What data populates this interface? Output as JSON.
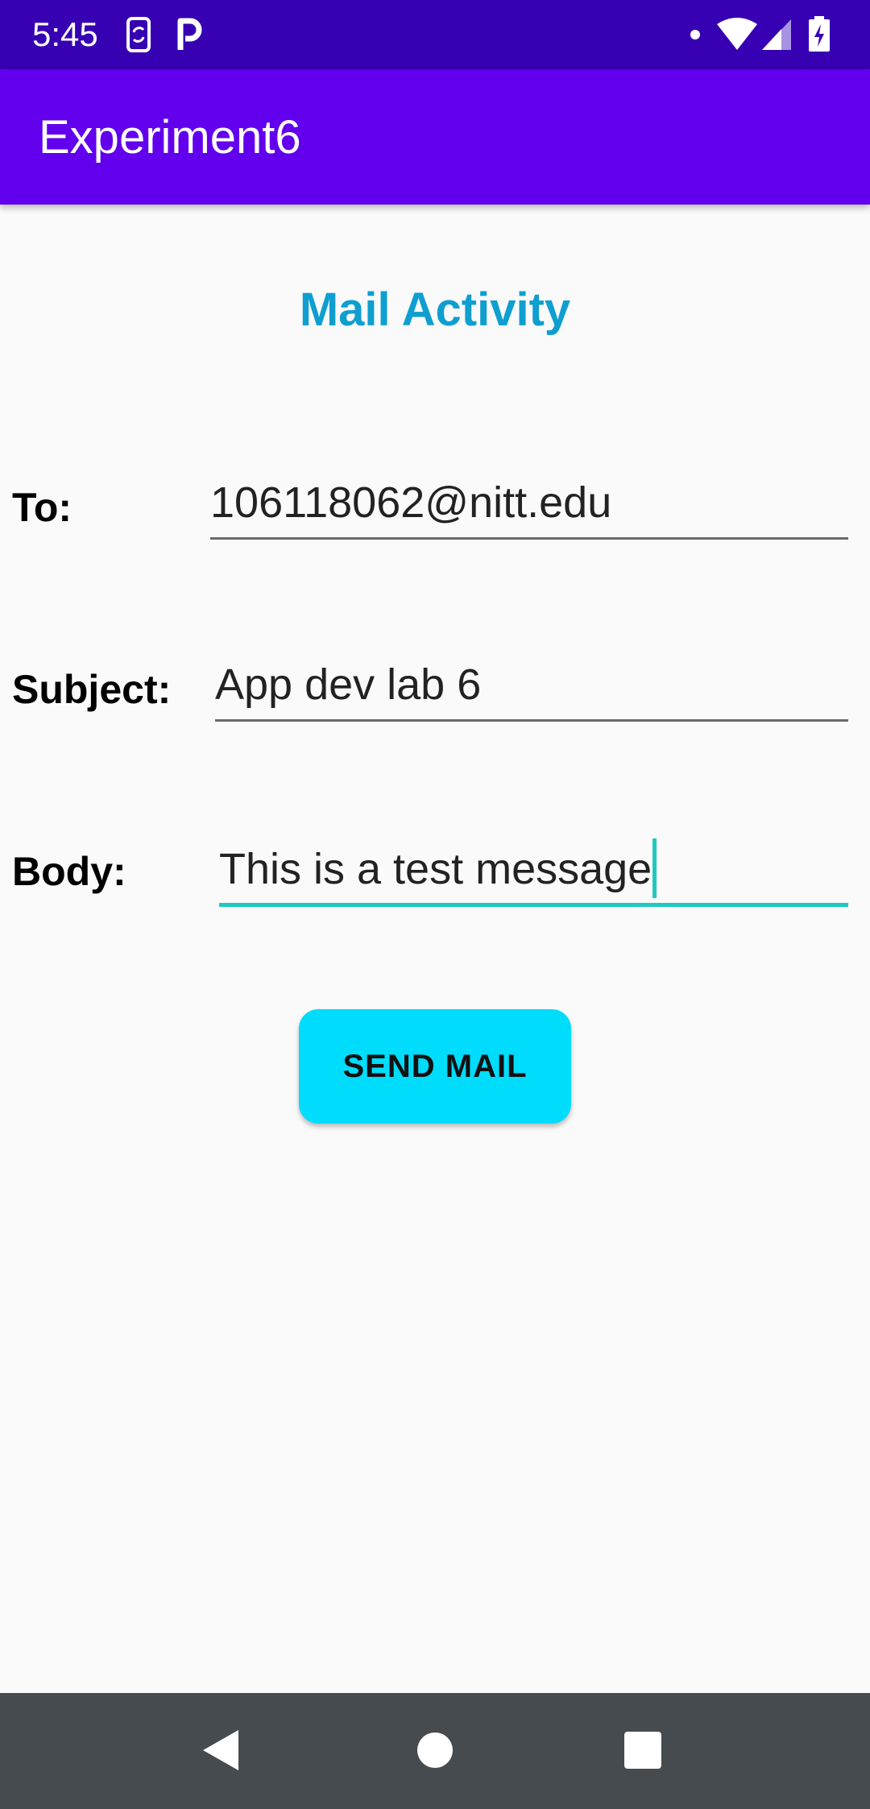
{
  "status_bar": {
    "time": "5:45",
    "icons": [
      "phone-sync-icon",
      "parking-app-icon",
      "notification-dot-icon",
      "wifi-icon",
      "cell-signal-icon",
      "battery-charging-icon"
    ],
    "background": "#3700b3"
  },
  "app_bar": {
    "title": "Experiment6",
    "background": "#6200ee"
  },
  "screen": {
    "heading": "Mail Activity",
    "heading_color": "#0e9fd0"
  },
  "form": {
    "to_label": "To:",
    "to_value": "106118062@nitt.edu",
    "subject_label": "Subject:",
    "subject_value": "App dev lab 6",
    "body_label": "Body:",
    "body_value": "This is a test message",
    "focus_color": "#1ec9c0"
  },
  "send_button": {
    "label": "SEND MAIL",
    "color": "#00dcfc"
  },
  "nav_bar": {
    "buttons": [
      "back-icon",
      "home-icon",
      "recents-icon"
    ],
    "background": "#454b4f"
  }
}
